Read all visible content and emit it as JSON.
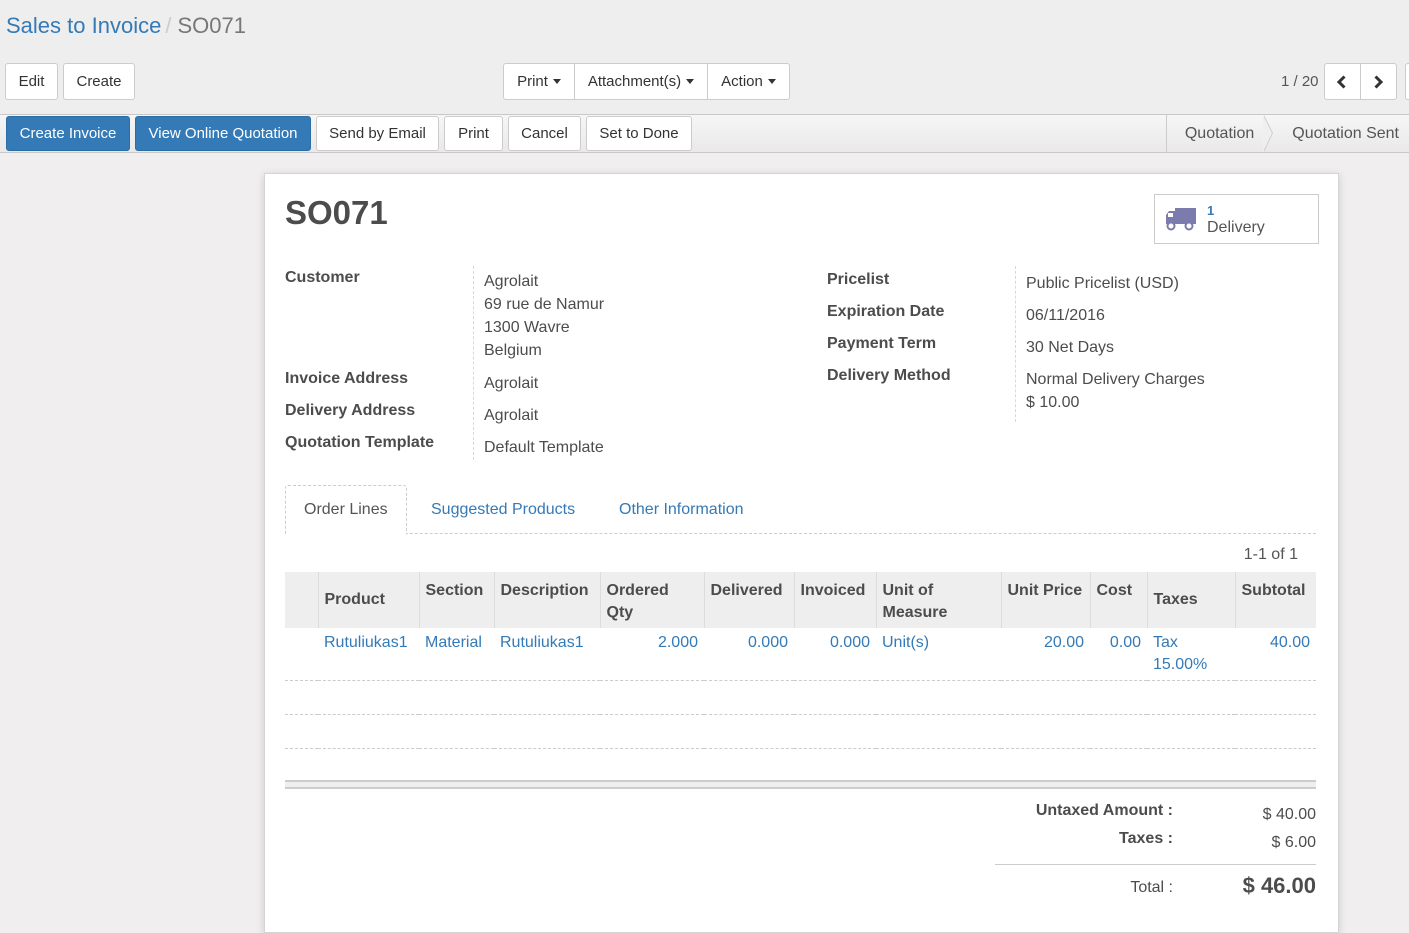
{
  "breadcrumb": {
    "parent": "Sales to Invoice",
    "separator": "/",
    "current": "SO071"
  },
  "toolbar": {
    "edit_label": "Edit",
    "create_label": "Create",
    "print_label": "Print",
    "attachments_label": "Attachment(s)",
    "action_label": "Action"
  },
  "pager": {
    "value": "1 / 20"
  },
  "statusbar": {
    "buttons": [
      "Create Invoice",
      "View Online Quotation",
      "Send by Email",
      "Print",
      "Cancel",
      "Set to Done"
    ],
    "stages": [
      "Quotation",
      "Quotation Sent"
    ]
  },
  "record": {
    "title": "SO071",
    "smart_button": {
      "count": "1",
      "label": "Delivery",
      "icon": "truck-icon"
    },
    "left_fields": {
      "customer_label": "Customer",
      "customer_name": "Agrolait",
      "customer_address": [
        "69 rue de Namur",
        "1300 Wavre",
        "Belgium"
      ],
      "invoice_address_label": "Invoice Address",
      "invoice_address": "Agrolait",
      "delivery_address_label": "Delivery Address",
      "delivery_address": "Agrolait",
      "template_label": "Quotation Template",
      "template": "Default Template"
    },
    "right_fields": {
      "pricelist_label": "Pricelist",
      "pricelist": "Public Pricelist (USD)",
      "expiration_label": "Expiration Date",
      "expiration": "06/11/2016",
      "payment_term_label": "Payment Term",
      "payment_term": "30 Net Days",
      "delivery_method_label": "Delivery Method",
      "delivery_method": "Normal Delivery Charges",
      "delivery_price": "$ 10.00"
    }
  },
  "tabs": [
    "Order Lines",
    "Suggested Products",
    "Other Information"
  ],
  "order_lines": {
    "pager": "1-1 of 1",
    "columns": [
      "Product",
      "Section",
      "Description",
      "Ordered Qty",
      "Delivered",
      "Invoiced",
      "Unit of Measure",
      "Unit Price",
      "Cost",
      "Taxes",
      "Subtotal"
    ],
    "rows": [
      {
        "product": "Rutuliukas1",
        "section": "Material",
        "description": "Rutuliukas1",
        "ordered_qty": "2.000",
        "delivered": "0.000",
        "invoiced": "0.000",
        "uom": "Unit(s)",
        "unit_price": "20.00",
        "cost": "0.00",
        "taxes": "Tax 15.00%",
        "subtotal": "40.00"
      }
    ]
  },
  "totals": {
    "untaxed_label": "Untaxed Amount :",
    "untaxed": "$ 40.00",
    "taxes_label": "Taxes :",
    "taxes": "$ 6.00",
    "total_label": "Total :",
    "total": "$ 46.00"
  },
  "colors": {
    "primary": "#337ab7",
    "truck": "#7c7bad"
  }
}
